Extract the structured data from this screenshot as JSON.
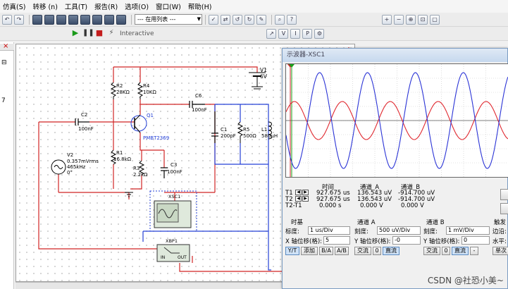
{
  "menu": [
    "仿真(S)",
    "转移 (n)",
    "工具(T)",
    "报告(R)",
    "选项(O)",
    "窗口(W)",
    "帮助(H)"
  ],
  "toolbar": {
    "list_select": "--- 在用列表 ---",
    "interactive_label": "Interactive"
  },
  "left_panel": {
    "number": "7"
  },
  "schematic": {
    "components": {
      "v1_name": "V1",
      "v1_value": "6V",
      "r2_name": "R2",
      "r2_value": "28KΩ",
      "r4_name": "R4",
      "r4_value": "10KΩ",
      "c6_name": "C6",
      "c6_value": "100nF",
      "q1_name": "Q1",
      "q1_model": "PMBT2369",
      "c2_name": "C2",
      "c2_value": "100nF",
      "c1_name": "C1",
      "c1_value": "200pF",
      "r5_name": "R5",
      "r5_value": "500Ω",
      "l1_name": "L1",
      "l1_value": "580µH",
      "v2_name": "V2",
      "v2_value": "0.357mVrms",
      "v2_freq": "465kHz",
      "v2_phase": "0°",
      "r1_name": "R1",
      "r1_value": "16.8kΩ",
      "r3_name": "R3",
      "r3_value": "2.2kΩ",
      "c3_name": "C3",
      "c3_value": "100nF",
      "xsc1_name": "XSC1",
      "xbp1_name": "XBP1",
      "bp_in": "IN",
      "bp_out": "OUT"
    }
  },
  "scope": {
    "title": "示波器-XSC1",
    "readout_headers": [
      "时间",
      "通道_A",
      "通道_B"
    ],
    "rows": [
      {
        "label": "T1",
        "time": "927.675 us",
        "a": "136.543 uV",
        "b": "-914.700 uV"
      },
      {
        "label": "T2",
        "time": "927.675 us",
        "a": "136.543 uV",
        "b": "-914.700 uV"
      },
      {
        "label": "T2-T1",
        "time": "0.000 s",
        "a": "0.000 V",
        "b": "0.000 V"
      }
    ],
    "timebase": {
      "header": "时基",
      "scale_label": "标度:",
      "scale": "1 us/Div",
      "xpos_label": "X 轴位移(格):",
      "xpos": "5",
      "buttons": [
        "Y/T",
        "添加",
        "B/A",
        "A/B"
      ]
    },
    "channel_a": {
      "header": "通道 A",
      "scale_label": "刻度:",
      "scale": "500 uV/Div",
      "ypos_label": "Y 轴位移(格):",
      "ypos": "-0",
      "buttons": [
        "交流",
        "0",
        "直流"
      ]
    },
    "channel_b": {
      "header": "通道 B",
      "scale_label": "刻度:",
      "scale": "1 mV/Div",
      "ypos_label": "Y 轴位移(格):",
      "ypos": "0",
      "buttons": [
        "交流",
        "0",
        "直流",
        "-"
      ]
    },
    "trigger": {
      "header": "触发",
      "edge_label": "边沿:",
      "level_label": "水平:",
      "single_label": "单次"
    },
    "colors": {
      "channel_a": "#e0282f",
      "channel_b": "#2b34d6",
      "cursor_red": "#d0202a",
      "cursor_green": "#1aa01a"
    }
  },
  "watermark": "CSDN @社恐小美~"
}
